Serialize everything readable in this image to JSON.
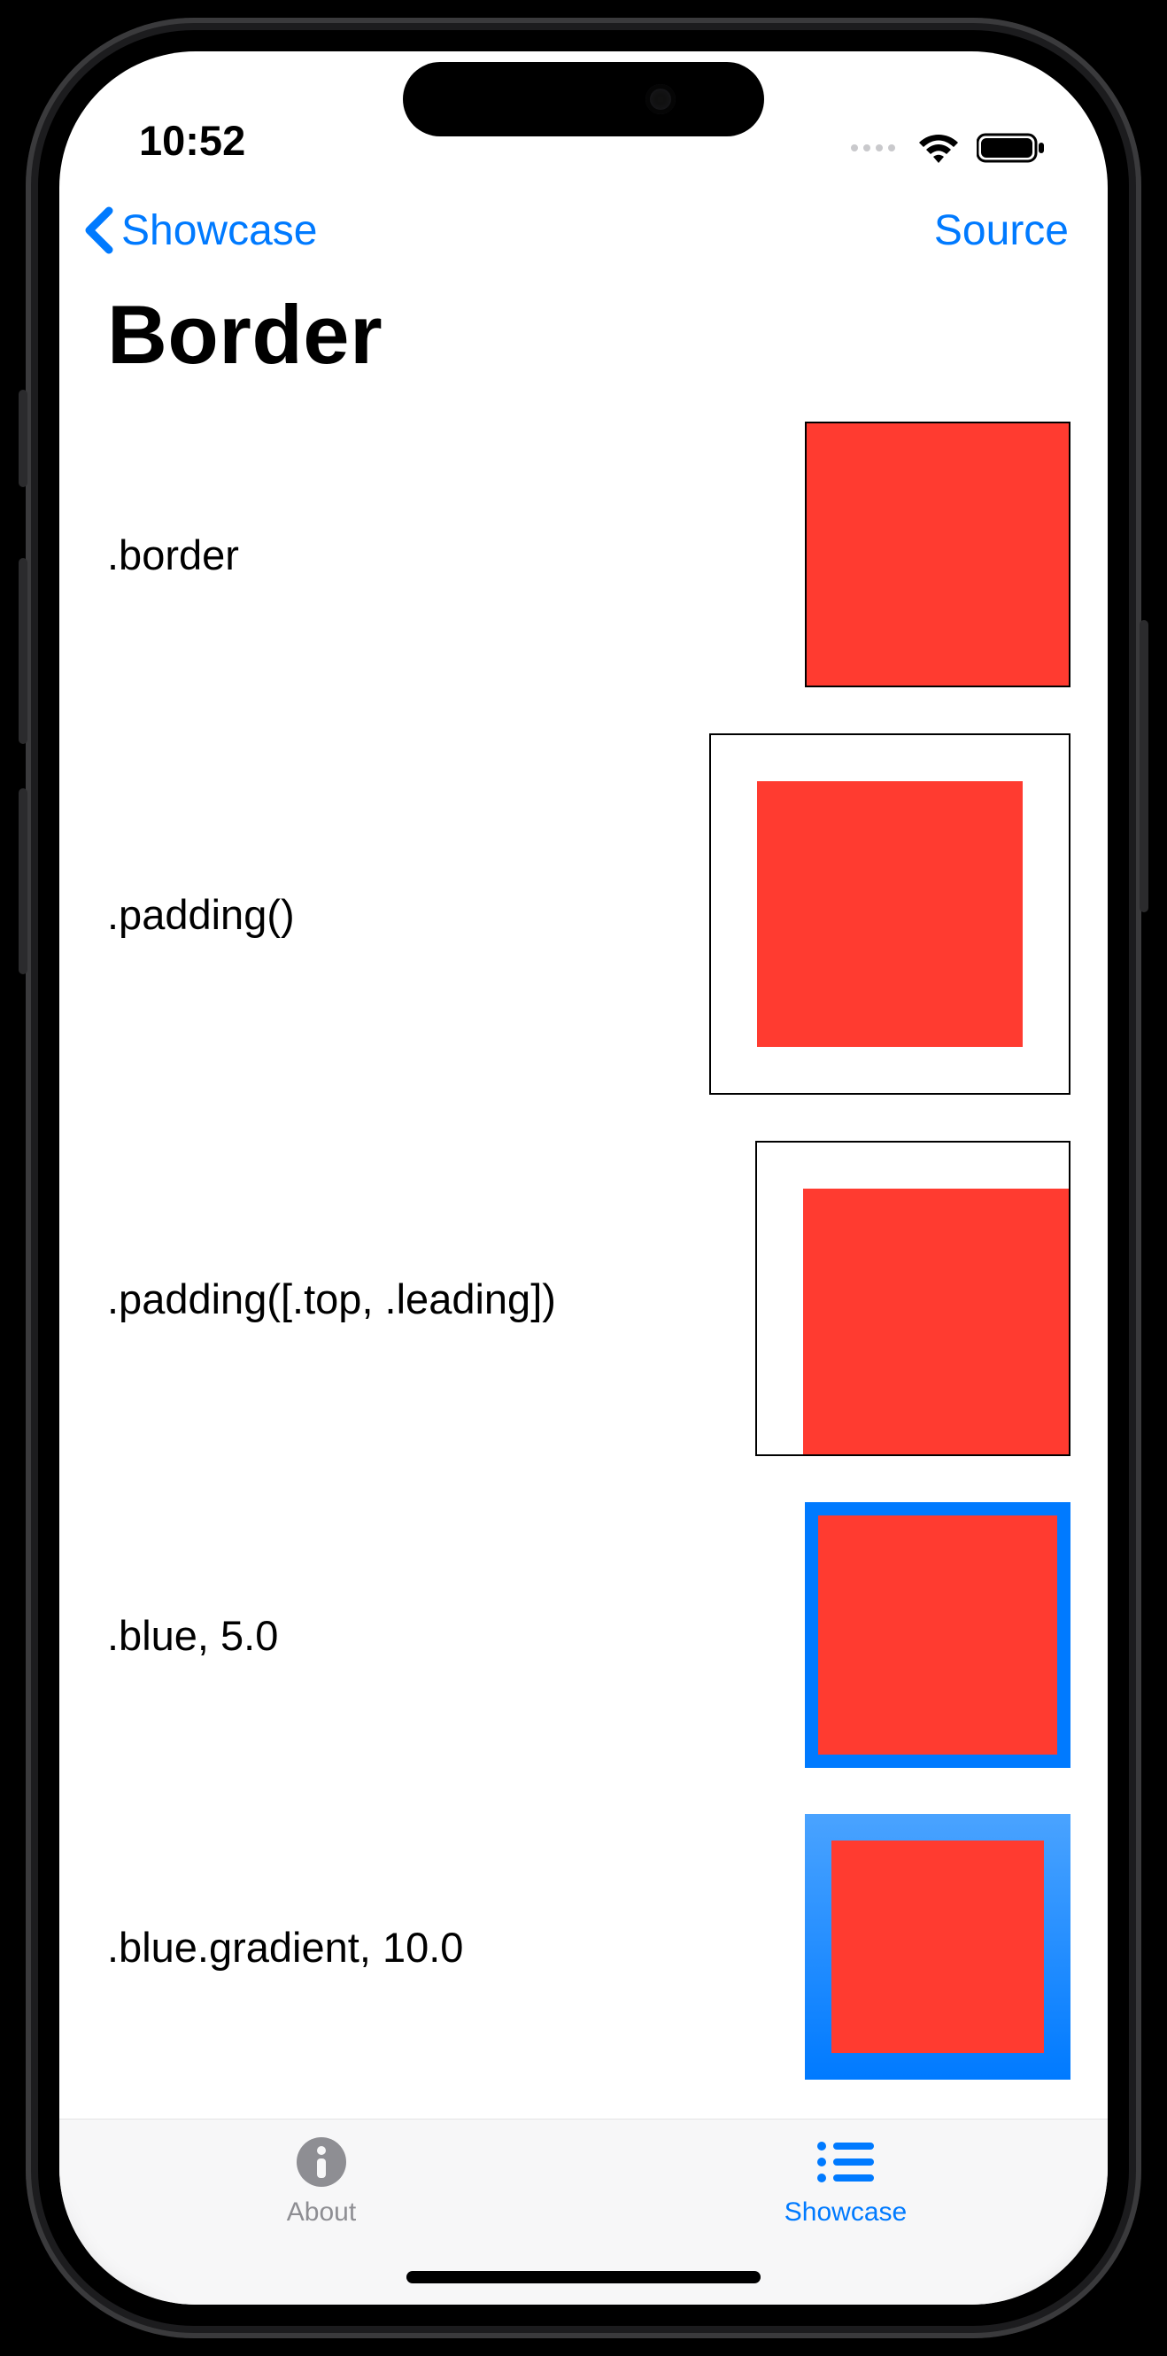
{
  "status": {
    "time": "10:52"
  },
  "nav": {
    "back_label": "Showcase",
    "action_label": "Source"
  },
  "page": {
    "title": "Border"
  },
  "rows": [
    {
      "label": ".border"
    },
    {
      "label": ".padding()"
    },
    {
      "label": ".padding([.top, .leading])"
    },
    {
      "label": ".blue, 5.0"
    },
    {
      "label": ".blue.gradient, 10.0"
    }
  ],
  "tabs": {
    "about": "About",
    "showcase": "Showcase"
  },
  "colors": {
    "accent": "#007aff",
    "fill": "#ff3b30"
  }
}
